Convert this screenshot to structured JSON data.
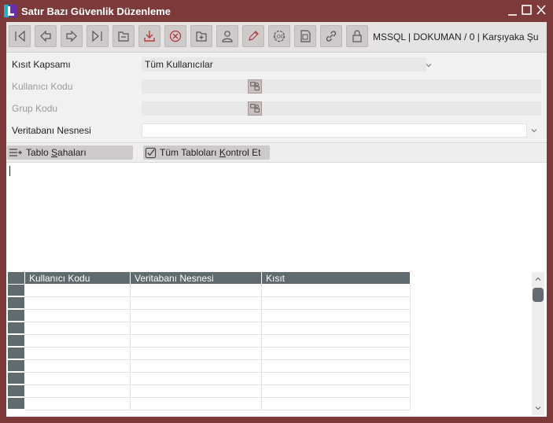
{
  "window": {
    "title": "Satır Bazı Güvenlik Düzenleme",
    "icon": "app-logo-icon",
    "controls": [
      "minimize-icon",
      "maximize-icon",
      "close-icon"
    ]
  },
  "toolbar": {
    "buttons": [
      {
        "name": "first-record-button",
        "icon": "first-icon"
      },
      {
        "name": "previous-record-button",
        "icon": "arrow-left-icon"
      },
      {
        "name": "next-record-button",
        "icon": "arrow-right-icon"
      },
      {
        "name": "last-record-button",
        "icon": "last-icon"
      },
      {
        "name": "minimize-form-button",
        "icon": "minus-box-icon"
      },
      {
        "name": "save-button",
        "icon": "download-icon"
      },
      {
        "name": "delete-button",
        "icon": "cancel-circle-icon"
      },
      {
        "name": "add-button",
        "icon": "plus-folder-icon"
      },
      {
        "name": "user-button",
        "icon": "user-icon"
      },
      {
        "name": "edit-button",
        "icon": "pencil-icon"
      },
      {
        "name": "log-button",
        "icon": "log-icon"
      },
      {
        "name": "report-button",
        "icon": "report-icon"
      },
      {
        "name": "link-button",
        "icon": "link-icon"
      },
      {
        "name": "lock-button",
        "icon": "lock-icon"
      }
    ],
    "connection_info": "MSSQL | DOKUMAN / 0 | Karşıyaka Şu"
  },
  "form": {
    "kisit_kapsami": {
      "label": "Kısıt Kapsamı",
      "value": "Tüm Kullanıcılar"
    },
    "kullanici_kodu": {
      "label": "Kullanıcı Kodu",
      "value": ""
    },
    "grup_kodu": {
      "label": "Grup Kodu",
      "value": ""
    },
    "veritabani_nesnesi": {
      "label": "Veritabanı Nesnesi",
      "value": ""
    }
  },
  "subtoolbar": {
    "tablo_sahalari": "Tablo Sahaları",
    "tum_tablolari_kontrol": "Tüm Tabloları Kontrol Et"
  },
  "grid": {
    "columns": [
      "Kullanıcı Kodu",
      "Veritabanı Nesnesi",
      "Kısıt"
    ],
    "rows": [
      [
        "",
        "",
        ""
      ],
      [
        "",
        "",
        ""
      ],
      [
        "",
        "",
        ""
      ],
      [
        "",
        "",
        ""
      ],
      [
        "",
        "",
        ""
      ],
      [
        "",
        "",
        ""
      ],
      [
        "",
        "",
        ""
      ],
      [
        "",
        "",
        ""
      ],
      [
        "",
        "",
        ""
      ],
      [
        "",
        "",
        ""
      ]
    ]
  },
  "colors": {
    "window_frame": "#7d3a3a",
    "grid_header": "#5f6b6e",
    "button_bg": "#cfcaca"
  }
}
